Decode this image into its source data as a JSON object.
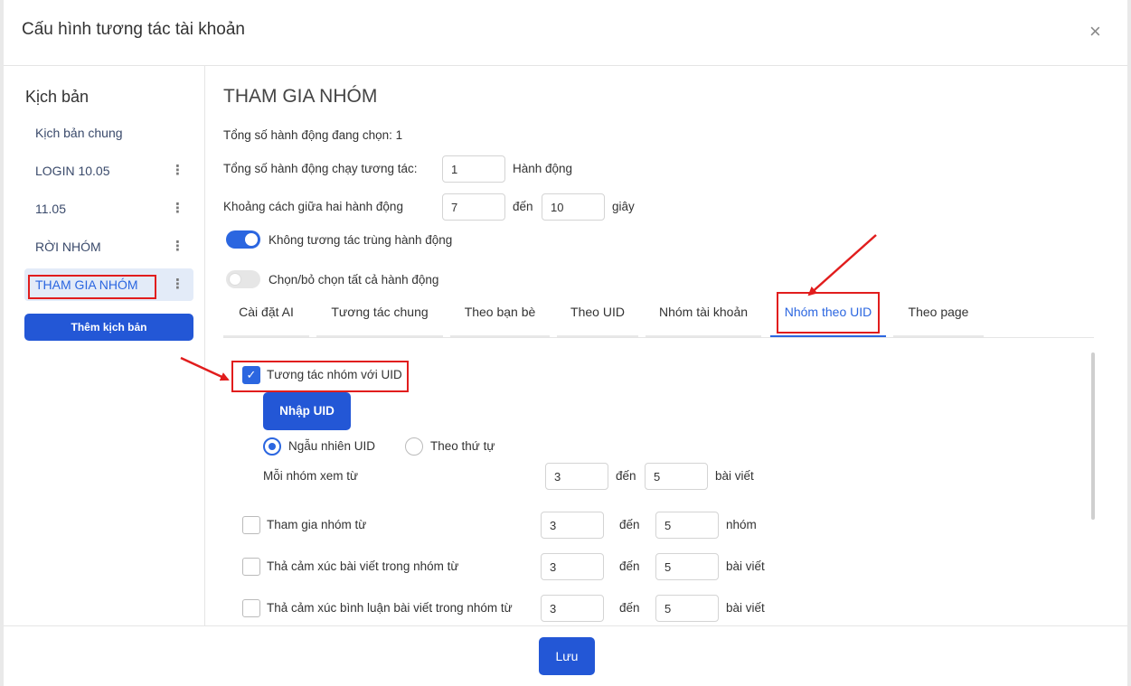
{
  "header": {
    "title": "Cấu hình tương tác tài khoản",
    "close_symbol": "×"
  },
  "sidebar": {
    "title": "Kịch bản",
    "items": [
      {
        "label": "Kịch bản chung",
        "has_menu": false
      },
      {
        "label": "LOGIN 10.05",
        "has_menu": true
      },
      {
        "label": "11.05",
        "has_menu": true
      },
      {
        "label": "RỜI NHÓM",
        "has_menu": true
      },
      {
        "label": "THAM GIA NHÓM",
        "has_menu": true,
        "active": true
      }
    ],
    "menu_symbol": "⋮",
    "add_button": "Thêm kịch bản"
  },
  "main": {
    "title": "THAM GIA NHÓM",
    "selected_count_text": "Tổng số hành động đang chọn: 1",
    "total_actions": {
      "label": "Tổng số hành động chạy tương tác:",
      "value": "1",
      "unit": "Hành động"
    },
    "interval": {
      "label": "Khoảng cách giữa hai hành động",
      "from": "7",
      "sep": "đến",
      "to": "10",
      "unit": "giây"
    },
    "no_repeat_toggle": {
      "label": "Không tương tác trùng hành động",
      "on": true
    },
    "select_all_toggle": {
      "label": "Chọn/bỏ chọn tất cả hành động",
      "on": false
    },
    "tabs": [
      {
        "label": "Cài đặt AI"
      },
      {
        "label": "Tương tác chung"
      },
      {
        "label": "Theo bạn bè"
      },
      {
        "label": "Theo UID"
      },
      {
        "label": "Nhóm tài khoản"
      },
      {
        "label": "Nhóm theo UID",
        "active": true
      },
      {
        "label": "Theo page"
      }
    ],
    "group_uid": {
      "checkbox_label": "Tương tác nhóm với UID",
      "checked": true,
      "import_button": "Nhập UID",
      "radio_random": "Ngẫu nhiên UID",
      "radio_order": "Theo thứ tự",
      "radio_selected": "random",
      "view_row": {
        "label": "Mỗi nhóm xem từ",
        "from": "3",
        "sep": "đến",
        "to": "5",
        "unit": "bài viết"
      }
    },
    "options": [
      {
        "label": "Tham gia nhóm từ",
        "from": "3",
        "sep": "đến",
        "to": "5",
        "unit": "nhóm",
        "checked": false
      },
      {
        "label": "Thả cảm xúc bài viết trong nhóm từ",
        "from": "3",
        "sep": "đến",
        "to": "5",
        "unit": "bài viết",
        "checked": false
      },
      {
        "label": "Thả cảm xúc bình luận bài viết trong nhóm từ",
        "from": "3",
        "sep": "đến",
        "to": "5",
        "unit": "bài viết",
        "checked": false
      }
    ]
  },
  "footer": {
    "save_button": "Lưu"
  },
  "colors": {
    "primary": "#2357d6",
    "accent": "#2b66e0",
    "annotation": "#e11d1d"
  },
  "icons": {
    "check": "check-icon",
    "close": "close-icon",
    "menu": "more-vertical-icon"
  }
}
